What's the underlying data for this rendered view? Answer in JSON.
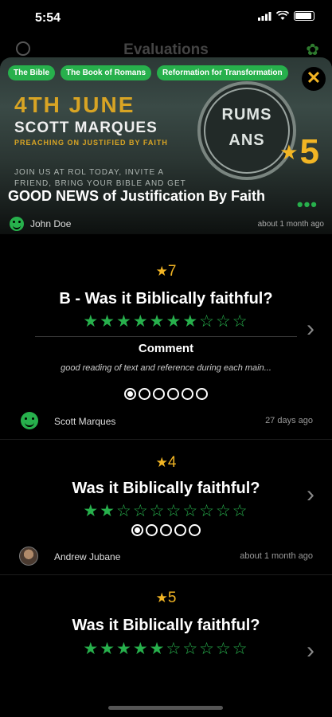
{
  "status": {
    "time": "5:54"
  },
  "nav": {
    "title": "Evaluations"
  },
  "hero": {
    "tags": [
      "The Bible",
      "The Book of Romans",
      "Reformation for Transformation"
    ],
    "close_glyph": "✕",
    "date_text": "4TH JUNE",
    "speaker": "SCOTT MARQUES",
    "preaching": "PREACHING ON JUSTIFIED BY FAITH",
    "invite_line1": "JOIN US AT ROL TODAY, INVITE A",
    "invite_line2": "FRIEND, BRING YOUR BIBLE AND GET",
    "logo_text": "RUMS ANS",
    "overall_score": "5",
    "title": "GOOD NEWS of Justification By Faith",
    "author": "John Doe",
    "time_ago": "about 1 month ago"
  },
  "cards": [
    {
      "score": "7",
      "question": "B - Was it Biblically faithful?",
      "stars": "★★★★★★★☆☆☆",
      "comment_header": "Comment",
      "comment_text": "good reading of text and reference during each main...",
      "pages": 6,
      "active_page": 0,
      "author": "Scott Marques",
      "time_ago": "27 days ago"
    },
    {
      "score": "4",
      "question": "Was it Biblically faithful?",
      "stars": "★★☆☆☆☆☆☆☆☆",
      "pages": 5,
      "active_page": 0,
      "author": "Andrew Jubane",
      "time_ago": "about 1 month ago"
    },
    {
      "score": "5",
      "question": "Was it Biblically faithful?",
      "stars": "★★★★★☆☆☆☆☆"
    }
  ],
  "colors": {
    "accent_green": "#27b04c",
    "score_gold": "#f2b524",
    "background": "#000000"
  }
}
